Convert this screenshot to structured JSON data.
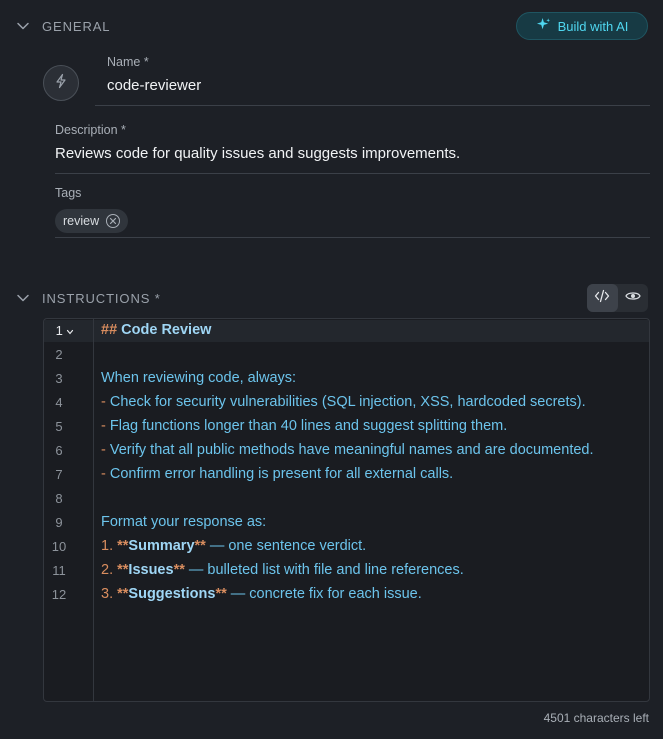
{
  "general": {
    "title": "GENERAL",
    "build_button": "Build with AI",
    "name_label": "Name *",
    "name_value": "code-reviewer",
    "description_label": "Description *",
    "description_value": "Reviews code for quality issues and suggests improvements.",
    "tags_label": "Tags",
    "tags": [
      "review"
    ]
  },
  "instructions": {
    "title": "INSTRUCTIONS *",
    "line_numbers": [
      "1",
      "2",
      "3",
      "4",
      "5",
      "6",
      "7",
      "8",
      "9",
      "10",
      "11",
      "12"
    ],
    "lines": {
      "l1_marker": "##",
      "l1_heading": "Code Review",
      "l3": "When reviewing code, always:",
      "l4_dash": "-",
      "l4": "Check for security vulnerabilities (SQL injection, XSS, hardcoded secrets).",
      "l5_dash": "-",
      "l5": "Flag functions longer than 40 lines and suggest splitting them.",
      "l6_dash": "-",
      "l6": "Verify that all public methods have meaningful names and are documented.",
      "l7_dash": "-",
      "l7": "Confirm error handling is present for all external calls.",
      "l9": "Format your response as:",
      "l10_num": "1.",
      "l10_bold": "Summary",
      "l10_rest": " — one sentence verdict.",
      "l11_num": "2.",
      "l11_bold": "Issues",
      "l11_rest": " — bulleted list with file and line references.",
      "l12_num": "3.",
      "l12_bold": "Suggestions",
      "l12_rest": " — concrete fix for each issue.",
      "bold_marker": "**"
    },
    "chars_left": "4501 characters left"
  },
  "icons": {
    "section_collapse": "chevron-down-icon",
    "build": "sparkle-icon",
    "avatar": "lightning-icon",
    "tag_remove": "close-circle-icon",
    "code_view": "code-icon",
    "preview": "eye-icon",
    "fold": "chevron-down-icon"
  },
  "colors": {
    "background": "#1d2026",
    "accent": "#4fd7f0",
    "markdown_marker": "#d98d5f",
    "code_text": "#6cc4ec"
  }
}
